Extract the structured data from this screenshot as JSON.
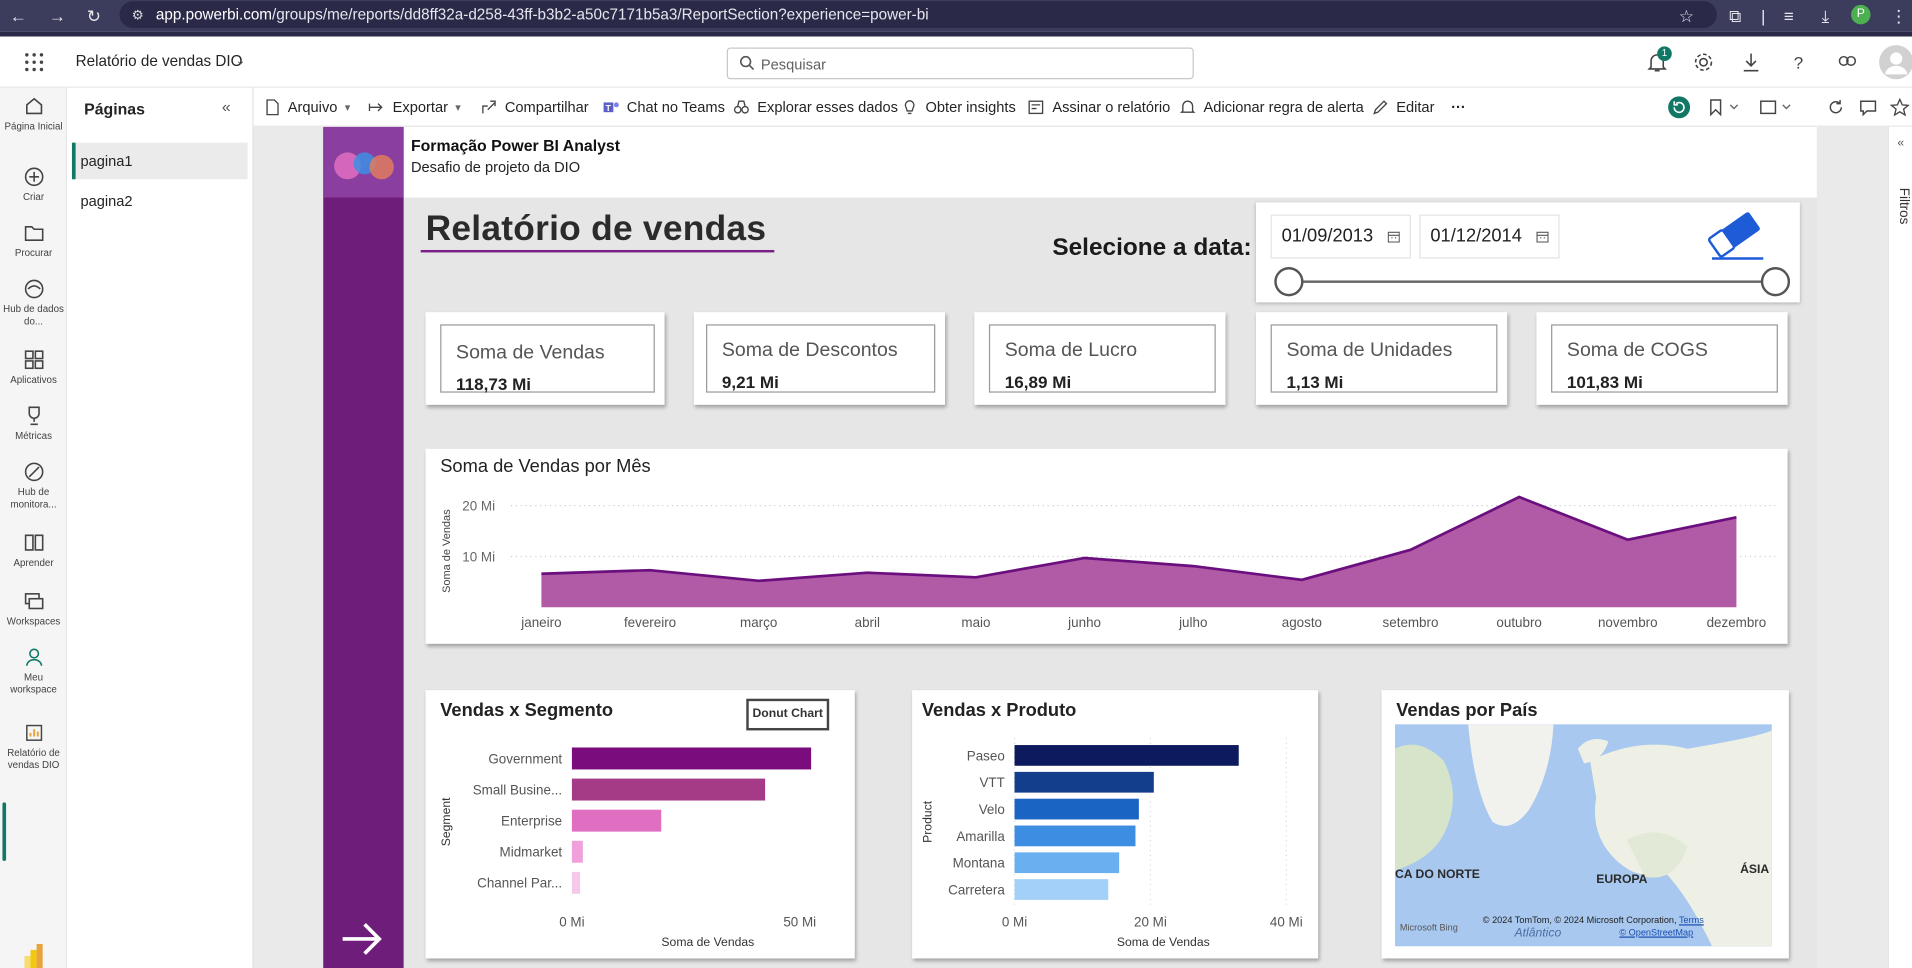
{
  "browser": {
    "url_host": "app.powerbi.com",
    "url_path": "/groups/me/reports/dd8ff32a-d258-43ff-b3b2-a50c7171b5a3/ReportSection?experience=power-bi",
    "profile_initial": "P"
  },
  "app": {
    "report_name": "Relatório de vendas DIO",
    "search_placeholder": "Pesquisar",
    "notification_count": "1"
  },
  "rail": [
    {
      "label": "Página Inicial",
      "icon": "home-icon"
    },
    {
      "label": "Criar",
      "icon": "plus-circle-icon"
    },
    {
      "label": "Procurar",
      "icon": "folder-icon"
    },
    {
      "label": "Hub de dados do...",
      "icon": "data-hub-icon"
    },
    {
      "label": "Aplicativos",
      "icon": "apps-icon"
    },
    {
      "label": "Métricas",
      "icon": "trophy-icon"
    },
    {
      "label": "Hub de monitora...",
      "icon": "monitor-icon"
    },
    {
      "label": "Aprender",
      "icon": "book-icon"
    },
    {
      "label": "Workspaces",
      "icon": "workspaces-icon"
    },
    {
      "label": "Meu workspace",
      "icon": "person-icon"
    },
    {
      "label": "Relatório de vendas DIO",
      "icon": "report-icon"
    }
  ],
  "pages": {
    "title": "Páginas",
    "items": [
      "pagina1",
      "pagina2"
    ],
    "active": "pagina1"
  },
  "toolbar": {
    "file": "Arquivo",
    "export": "Exportar",
    "share": "Compartilhar",
    "teams": "Chat no Teams",
    "explore": "Explorar esses dados",
    "insights": "Obter insights",
    "subscribe": "Assinar o relatório",
    "alert": "Adicionar regra de alerta",
    "edit": "Editar",
    "more": "···"
  },
  "filters": {
    "label": "Filtros"
  },
  "report": {
    "header_title": "Formação Power BI Analyst",
    "header_subtitle": "Desafio de projeto da DIO",
    "title": "Relatório de vendas",
    "date_label": "Selecione a data:",
    "date_start": "01/09/2013",
    "date_end": "01/12/2014"
  },
  "cards": [
    {
      "label": "Soma de Vendas",
      "value": "118,73 Mi"
    },
    {
      "label": "Soma de Descontos",
      "value": "9,21 Mi"
    },
    {
      "label": "Soma de Lucro",
      "value": "16,89 Mi"
    },
    {
      "label": "Soma de Unidades",
      "value": "1,13 Mi"
    },
    {
      "label": "Soma de COGS",
      "value": "101,83 Mi"
    }
  ],
  "visual_titles": {
    "area": "Soma de Vendas por Mês",
    "segment": "Vendas x Segmento",
    "product": "Vendas x Produto",
    "country": "Vendas por País",
    "donut_button": "Donut Chart"
  },
  "map": {
    "labels": [
      "CA DO NORTE",
      "EUROPA",
      "ÁSIA",
      "Atlântico"
    ],
    "copyright": "© 2024 TomTom, © 2024 Microsoft Corporation,",
    "terms": "Terms",
    "osm": "© OpenStreetMap",
    "bing": "Microsoft Bing"
  },
  "colors": {
    "accent_purple": "#6f1d7a",
    "powerbi_green": "#117865",
    "area_line": "#6b0f7f",
    "area_fill": "#b15aa6"
  },
  "chart_data": [
    {
      "type": "area",
      "title": "Soma de Vendas por Mês",
      "ylabel": "Soma de Vendas",
      "categories": [
        "janeiro",
        "fevereiro",
        "março",
        "abril",
        "maio",
        "junho",
        "julho",
        "agosto",
        "setembro",
        "outubro",
        "novembro",
        "dezembro"
      ],
      "values": [
        6.6,
        7.3,
        5.2,
        6.8,
        5.9,
        9.7,
        8.1,
        5.4,
        11.3,
        21.7,
        13.3,
        17.7
      ],
      "y_ticks": [
        "10 Mi",
        "20 Mi"
      ],
      "ylim": [
        0,
        24
      ],
      "grid": true
    },
    {
      "type": "bar",
      "orientation": "horizontal",
      "title": "Vendas x Segmento",
      "xlabel": "Soma de Vendas",
      "ylabel": "Segment",
      "categories": [
        "Government",
        "Small Busine...",
        "Enterprise",
        "Midmarket",
        "Channel Par..."
      ],
      "values": [
        52.5,
        42.4,
        19.6,
        2.4,
        1.8
      ],
      "colors": [
        "#7b0c7d",
        "#a53a87",
        "#e16fc1",
        "#f0a0da",
        "#f6c8ea"
      ],
      "x_ticks": [
        {
          "v": 0,
          "label": "0 Mi"
        },
        {
          "v": 50,
          "label": "50 Mi"
        }
      ],
      "xlim": [
        0,
        57
      ]
    },
    {
      "type": "bar",
      "orientation": "horizontal",
      "title": "Vendas x Produto",
      "xlabel": "Soma de Vendas",
      "ylabel": "Product",
      "categories": [
        "Paseo",
        "VTT",
        "Velo",
        "Amarilla",
        "Montana",
        "Carretera"
      ],
      "values": [
        33.0,
        20.5,
        18.3,
        17.8,
        15.4,
        13.8
      ],
      "colors": [
        "#0d1b5e",
        "#123e8c",
        "#1a64c4",
        "#3d8ee3",
        "#6ab0f0",
        "#a3d0f8"
      ],
      "x_ticks": [
        {
          "v": 0,
          "label": "0 Mi"
        },
        {
          "v": 20,
          "label": "20 Mi"
        },
        {
          "v": 40,
          "label": "40 Mi"
        }
      ],
      "xlim": [
        0,
        42
      ]
    }
  ]
}
